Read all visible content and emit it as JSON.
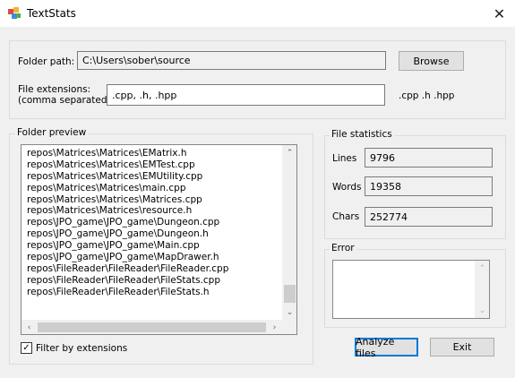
{
  "window": {
    "title": "TextStats",
    "close_glyph": "✕"
  },
  "config": {
    "folder_path_label": "Folder path:",
    "folder_path_value": "C:\\Users\\sober\\source",
    "browse_label": "Browse",
    "extensions_label_line1": "File extensions:",
    "extensions_label_line2": "(comma separated)",
    "extensions_value": ".cpp, .h, .hpp",
    "extensions_parsed": ".cpp .h .hpp"
  },
  "preview": {
    "group_label": "Folder preview",
    "items": [
      "repos\\Matrices\\Matrices\\EMatrix.h",
      "repos\\Matrices\\Matrices\\EMTest.cpp",
      "repos\\Matrices\\Matrices\\EMUtility.cpp",
      "repos\\Matrices\\Matrices\\main.cpp",
      "repos\\Matrices\\Matrices\\Matrices.cpp",
      "repos\\Matrices\\Matrices\\resource.h",
      "repos\\JPO_game\\JPO_game\\Dungeon.cpp",
      "repos\\JPO_game\\JPO_game\\Dungeon.h",
      "repos\\JPO_game\\JPO_game\\Main.cpp",
      "repos\\JPO_game\\JPO_game\\MapDrawer.h",
      "repos\\FileReader\\FileReader\\FileReader.cpp",
      "repos\\FileReader\\FileReader\\FileStats.cpp",
      "repos\\FileReader\\FileReader\\FileStats.h"
    ],
    "filter_label": "Filter by extensions",
    "filter_checked": true
  },
  "stats": {
    "group_label": "File statistics",
    "lines_label": "Lines",
    "lines_value": "9796",
    "words_label": "Words",
    "words_value": "19358",
    "chars_label": "Chars",
    "chars_value": "252774"
  },
  "error": {
    "group_label": "Error",
    "text": ""
  },
  "actions": {
    "analyze_label": "Analyze files",
    "exit_label": "Exit"
  }
}
